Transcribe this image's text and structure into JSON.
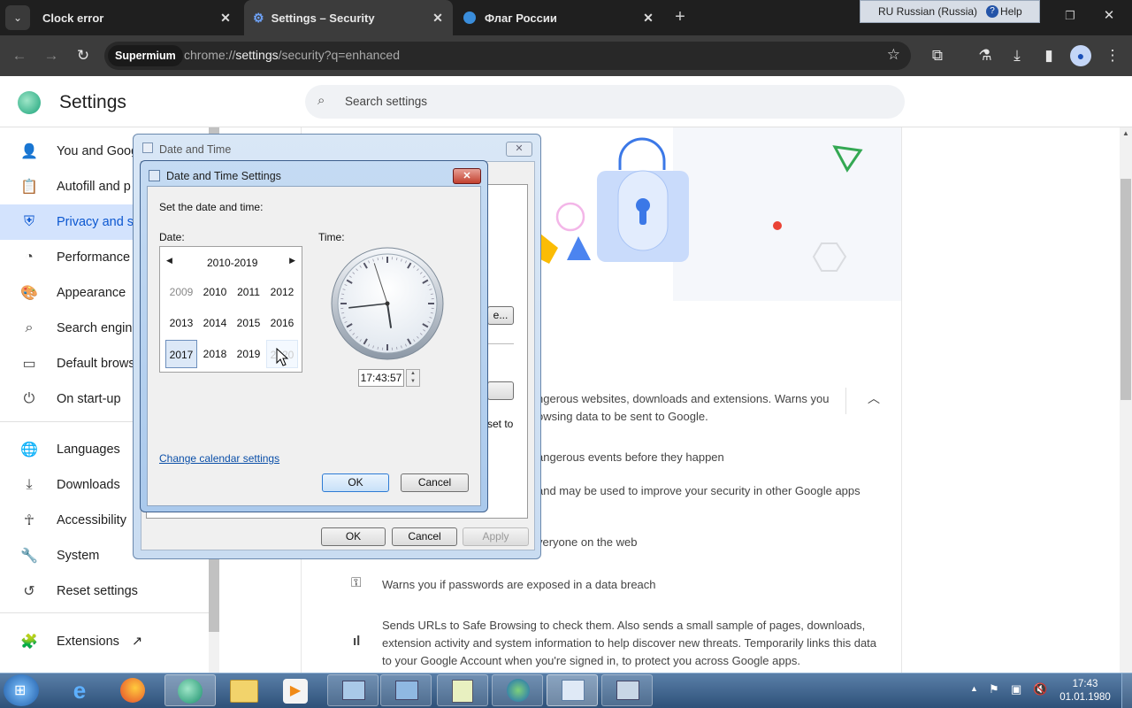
{
  "tabs": [
    {
      "title": "Clock error"
    },
    {
      "title": "Settings – Security"
    },
    {
      "title": "Флаг России"
    }
  ],
  "window_controls": {
    "lang": "RU Russian (Russia)",
    "help": "Help"
  },
  "omnibox": {
    "badge": "Supermium",
    "url_prefix": "chrome://",
    "url_host": "settings",
    "url_rest": "/security?q=enhanced"
  },
  "settings": {
    "title": "Settings",
    "search_placeholder": "Search settings",
    "nav": [
      {
        "label": "You and Goog",
        "icon": "person-icon"
      },
      {
        "label": "Autofill and p",
        "icon": "clipboard-icon"
      },
      {
        "label": "Privacy and se",
        "icon": "shield-icon"
      },
      {
        "label": "Performance",
        "icon": "speedometer-icon"
      },
      {
        "label": "Appearance",
        "icon": "palette-icon"
      },
      {
        "label": "Search engine",
        "icon": "search-icon"
      },
      {
        "label": "Default brows",
        "icon": "browser-icon"
      },
      {
        "label": "On start-up",
        "icon": "power-icon"
      },
      {
        "label": "Languages",
        "icon": "globe-icon"
      },
      {
        "label": "Downloads",
        "icon": "download-icon"
      },
      {
        "label": "Accessibility",
        "icon": "accessibility-icon"
      },
      {
        "label": "System",
        "icon": "wrench-icon"
      },
      {
        "label": "Reset settings",
        "icon": "history-icon"
      },
      {
        "label": "Extensions",
        "icon": "puzzle-icon"
      }
    ]
  },
  "content": {
    "line1": "ngerous websites, downloads and extensions. Warns you",
    "line2": "owsing data to be sent to Google.",
    "line3": "angerous events before they happen",
    "line4": "and may be used to improve your security in other Google apps",
    "line5": "veryone on the web",
    "line6": "Warns you if passwords are exposed in a data breach",
    "line7a": "Sends URLs to Safe Browsing to check them. Also sends a small sample of pages, downloads,",
    "line7b": "extension activity and system information to help discover new threats. Temporarily links this data",
    "line7c": "to your Google Account when you're signed in, to protect you across Google apps.",
    "partial_button": "e...",
    "partial_text": "set to"
  },
  "outer_dialog": {
    "title": "Date and Time",
    "ok": "OK",
    "cancel": "Cancel",
    "apply": "Apply"
  },
  "inner_dialog": {
    "title": "Date and Time Settings",
    "prompt": "Set the date and time:",
    "date_label": "Date:",
    "time_label": "Time:",
    "decade": "2010-2019",
    "years": [
      "2009",
      "2010",
      "2011",
      "2012",
      "2013",
      "2014",
      "2015",
      "2016",
      "2017",
      "2018",
      "2019",
      "2020"
    ],
    "selected_year": "2017",
    "time_value": "17:43:57",
    "change_link": "Change calendar settings",
    "ok": "OK",
    "cancel": "Cancel"
  },
  "clock": {
    "hour": 17,
    "minute": 43,
    "second": 57
  },
  "taskbar": {
    "time": "17:43",
    "date": "01.01.1980"
  },
  "colors": {
    "accent": "#0b57d0",
    "nav_active_bg": "#d3e3fd",
    "tab_bg": "#1f1f1f",
    "toolbar_bg": "#3c3c3c"
  }
}
